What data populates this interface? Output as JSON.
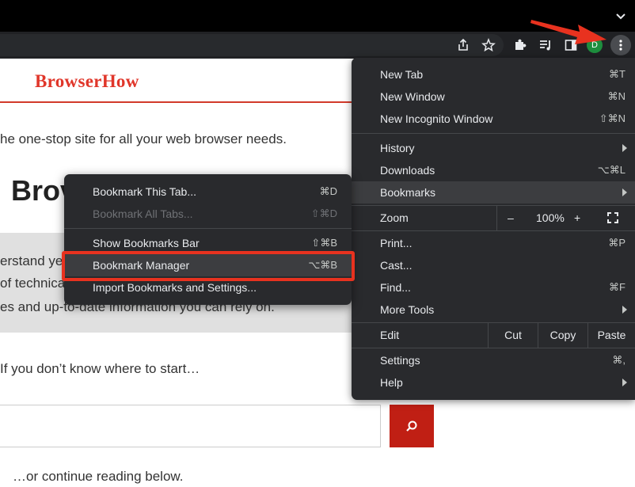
{
  "toolbar": {
    "profile_initial": "D",
    "icons": [
      "share-icon",
      "star-icon",
      "puzzle-icon",
      "media-icon",
      "sidepanel-icon",
      "kebab-menu-icon"
    ]
  },
  "site": {
    "logo": "BrowserHow",
    "tagline": "he one-stop site for all your web browser needs.",
    "heading": "Brov",
    "gray_lines": [
      "erstand ye",
      "of technical",
      "es and up-to-date information you can rely on."
    ],
    "start_text": "If you don’t know where to start…",
    "continue_text": "…or continue reading below."
  },
  "menu": {
    "new_tab": {
      "label": "New Tab",
      "shortcut": "⌘T"
    },
    "new_window": {
      "label": "New Window",
      "shortcut": "⌘N"
    },
    "incognito": {
      "label": "New Incognito Window",
      "shortcut": "⇧⌘N"
    },
    "history": {
      "label": "History"
    },
    "downloads": {
      "label": "Downloads",
      "shortcut": "⌥⌘L"
    },
    "bookmarks": {
      "label": "Bookmarks"
    },
    "zoom": {
      "label": "Zoom",
      "minus": "–",
      "level": "100%",
      "plus": "+"
    },
    "print": {
      "label": "Print...",
      "shortcut": "⌘P"
    },
    "cast": {
      "label": "Cast..."
    },
    "find": {
      "label": "Find...",
      "shortcut": "⌘F"
    },
    "more_tools": {
      "label": "More Tools"
    },
    "edit": {
      "label": "Edit",
      "cut": "Cut",
      "copy": "Copy",
      "paste": "Paste"
    },
    "settings": {
      "label": "Settings",
      "shortcut": "⌘,"
    },
    "help": {
      "label": "Help"
    }
  },
  "submenu": {
    "bookmark_tab": {
      "label": "Bookmark This Tab...",
      "shortcut": "⌘D"
    },
    "bookmark_all": {
      "label": "Bookmark All Tabs...",
      "shortcut": "⇧⌘D"
    },
    "show_bar": {
      "label": "Show Bookmarks Bar",
      "shortcut": "⇧⌘B"
    },
    "manager": {
      "label": "Bookmark Manager",
      "shortcut": "⌥⌘B"
    },
    "import": {
      "label": "Import Bookmarks and Settings..."
    }
  },
  "colors": {
    "menu_bg": "#292a2d",
    "highlight": "#e8321f",
    "brand_red": "#e0362a"
  }
}
